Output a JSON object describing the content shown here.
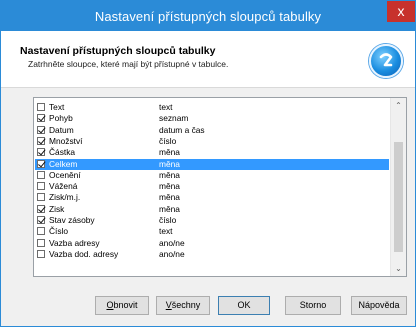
{
  "window": {
    "title": "Nastavení přístupných sloupců tabulky",
    "close_glyph": "x"
  },
  "header": {
    "title": "Nastavení přístupných sloupců tabulky",
    "subtitle": "Zatrhněte sloupce, které mají být přístupné v tabulce.",
    "icon": "app-logo-icon"
  },
  "columns": [
    {
      "name": "Text",
      "type": "text",
      "checked": false,
      "selected": false
    },
    {
      "name": "Pohyb",
      "type": "seznam",
      "checked": true,
      "selected": false
    },
    {
      "name": "Datum",
      "type": "datum a čas",
      "checked": true,
      "selected": false
    },
    {
      "name": "Množství",
      "type": "číslo",
      "checked": true,
      "selected": false
    },
    {
      "name": "Částka",
      "type": "měna",
      "checked": true,
      "selected": false
    },
    {
      "name": "Celkem",
      "type": "měna",
      "checked": true,
      "selected": true
    },
    {
      "name": "Ocenění",
      "type": "měna",
      "checked": false,
      "selected": false
    },
    {
      "name": "Vážená",
      "type": "měna",
      "checked": false,
      "selected": false
    },
    {
      "name": "Zisk/m.j.",
      "type": "měna",
      "checked": false,
      "selected": false
    },
    {
      "name": "Zisk",
      "type": "měna",
      "checked": true,
      "selected": false
    },
    {
      "name": "Stav zásoby",
      "type": "číslo",
      "checked": true,
      "selected": false
    },
    {
      "name": "Číslo",
      "type": "text",
      "checked": false,
      "selected": false
    },
    {
      "name": "Vazba adresy",
      "type": "ano/ne",
      "checked": false,
      "selected": false
    },
    {
      "name": "Vazba dod. adresy",
      "type": "ano/ne",
      "checked": false,
      "selected": false
    }
  ],
  "buttons": {
    "refresh": {
      "pre": "",
      "u": "O",
      "post": "bnovit"
    },
    "all": {
      "pre": "",
      "u": "V",
      "post": "šechny"
    },
    "ok": "OK",
    "cancel": "Storno",
    "help": "Nápověda"
  },
  "colors": {
    "titlebar": "#2b8bd7",
    "selection": "#3399ff",
    "close": "#c7312c"
  }
}
